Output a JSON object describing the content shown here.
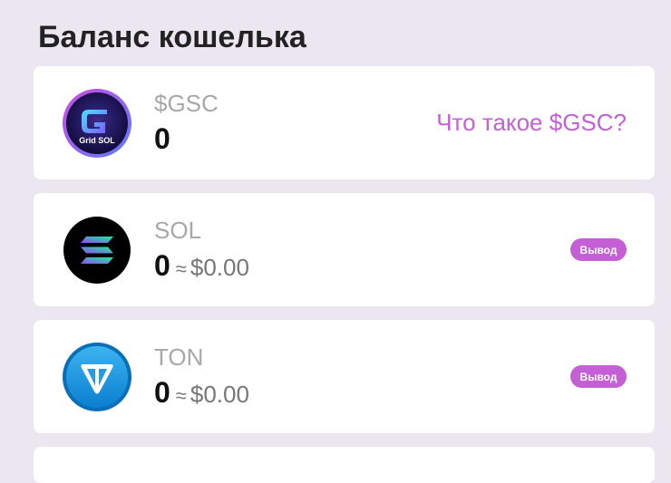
{
  "page": {
    "title": "Баланс кошелька"
  },
  "wallets": [
    {
      "ticker": "$GSC",
      "amount": "0",
      "link_label": "Что такое $GSC?",
      "logo": "grid-sol-logo",
      "logo_text": "Grid SOL"
    },
    {
      "ticker": "SOL",
      "amount": "0",
      "approx": "≈",
      "usd_value": "$0.00",
      "action_label": "Вывод",
      "logo": "solana-logo"
    },
    {
      "ticker": "TON",
      "amount": "0",
      "approx": "≈",
      "usd_value": "$0.00",
      "action_label": "Вывод",
      "logo": "ton-logo"
    }
  ],
  "colors": {
    "accent": "#c45fd6",
    "background": "#ebe6f0",
    "card": "#ffffff",
    "muted": "#a8a8a8"
  }
}
